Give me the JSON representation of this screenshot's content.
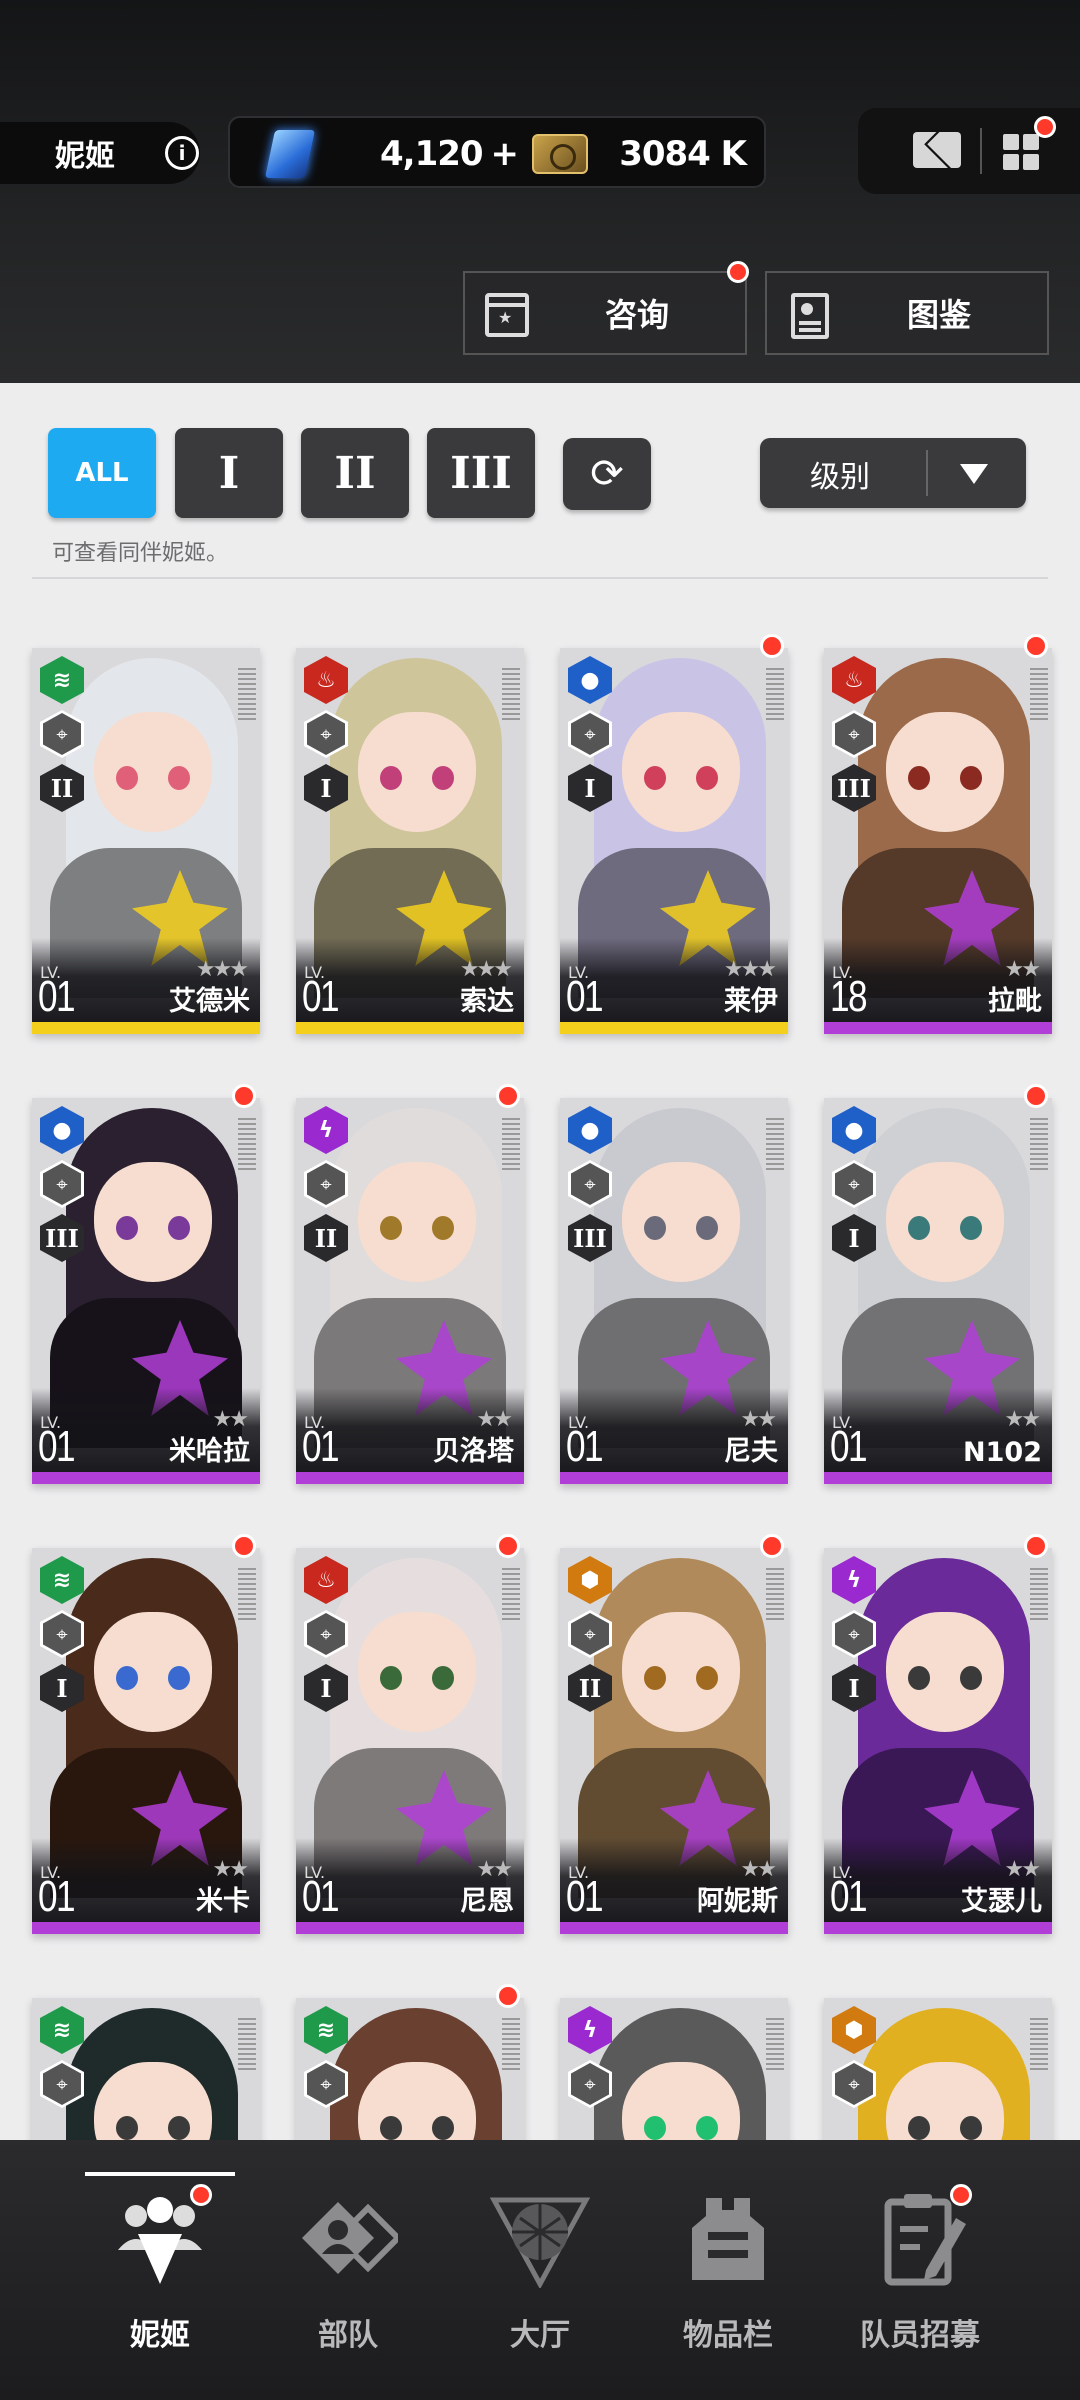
{
  "header": {
    "nikke_label": "妮姬",
    "gems": "4,120",
    "gems_plus": "+",
    "credits": "3084 K",
    "consult_label": "咨询",
    "codex_label": "图鉴"
  },
  "filters": {
    "all": "ALL",
    "burst_1": "I",
    "burst_2": "II",
    "burst_3": "III",
    "sort_label": "级别",
    "hint": "可查看同伴妮姬。"
  },
  "cards": [
    {
      "name": "艾德米",
      "lv_label": "LV.",
      "level": "01",
      "burst": "II",
      "element": "wind",
      "element_color": "#1f9a4a",
      "rarity_strip": "#f4d01c",
      "hair": "#e3e6ea",
      "eye": "#e0607a",
      "dot": false,
      "stars": "★★★"
    },
    {
      "name": "索达",
      "lv_label": "LV.",
      "level": "01",
      "burst": "I",
      "element": "fire",
      "element_color": "#c8281e",
      "rarity_strip": "#f4d01c",
      "hair": "#cfc59a",
      "eye": "#c2407a",
      "dot": false,
      "stars": "★★★"
    },
    {
      "name": "莱伊",
      "lv_label": "LV.",
      "level": "01",
      "burst": "I",
      "element": "water",
      "element_color": "#1f5fc8",
      "rarity_strip": "#f4d01c",
      "hair": "#c9c3e6",
      "eye": "#d0405a",
      "dot": true,
      "stars": "★★★"
    },
    {
      "name": "拉毗",
      "lv_label": "LV.",
      "level": "18",
      "burst": "III",
      "element": "fire",
      "element_color": "#c8281e",
      "rarity_strip": "#b23ed8",
      "hair": "#9a6a4a",
      "eye": "#8a2a20",
      "dot": true,
      "stars": "★★"
    },
    {
      "name": "米哈拉",
      "lv_label": "LV.",
      "level": "01",
      "burst": "III",
      "element": "water",
      "element_color": "#1f5fc8",
      "rarity_strip": "#b23ed8",
      "hair": "#2a2030",
      "eye": "#7a3a9a",
      "dot": true,
      "stars": "★★"
    },
    {
      "name": "贝洛塔",
      "lv_label": "LV.",
      "level": "01",
      "burst": "II",
      "element": "electric",
      "element_color": "#9a2ad0",
      "rarity_strip": "#b23ed8",
      "hair": "#e0dcdc",
      "eye": "#a07a2a",
      "dot": true,
      "stars": "★★"
    },
    {
      "name": "尼夫",
      "lv_label": "LV.",
      "level": "01",
      "burst": "III",
      "element": "water",
      "element_color": "#1f5fc8",
      "rarity_strip": "#b23ed8",
      "hair": "#c9cad0",
      "eye": "#6a6a7a",
      "dot": false,
      "stars": "★★"
    },
    {
      "name": "N102",
      "lv_label": "LV.",
      "level": "01",
      "burst": "I",
      "element": "water",
      "element_color": "#1f5fc8",
      "rarity_strip": "#b23ed8",
      "hair": "#cfd0d4",
      "eye": "#3a7a7a",
      "dot": true,
      "stars": "★★"
    },
    {
      "name": "米卡",
      "lv_label": "LV.",
      "level": "01",
      "burst": "I",
      "element": "wind",
      "element_color": "#1f9a4a",
      "rarity_strip": "#b23ed8",
      "hair": "#4a2a1a",
      "eye": "#3a6ad0",
      "dot": true,
      "stars": "★★"
    },
    {
      "name": "尼恩",
      "lv_label": "LV.",
      "level": "01",
      "burst": "I",
      "element": "fire",
      "element_color": "#c8281e",
      "rarity_strip": "#b23ed8",
      "hair": "#e6dede",
      "eye": "#3a6a3a",
      "dot": true,
      "stars": "★★"
    },
    {
      "name": "阿妮斯",
      "lv_label": "LV.",
      "level": "01",
      "burst": "II",
      "element": "iron",
      "element_color": "#d07a10",
      "rarity_strip": "#b23ed8",
      "hair": "#b08a5a",
      "eye": "#a06a20",
      "dot": true,
      "stars": "★★"
    },
    {
      "name": "艾瑟儿",
      "lv_label": "LV.",
      "level": "01",
      "burst": "I",
      "element": "electric",
      "element_color": "#9a2ad0",
      "rarity_strip": "#b23ed8",
      "hair": "#6a2a9a",
      "eye": "#3a3a3a",
      "dot": true,
      "stars": "★★"
    },
    {
      "name": "",
      "lv_label": "",
      "level": "",
      "burst": "",
      "element": "wind",
      "element_color": "#1f9a4a",
      "rarity_strip": "#b23ed8",
      "hair": "#1f2a2a",
      "eye": "#3a3a3a",
      "dot": false,
      "stars": ""
    },
    {
      "name": "",
      "lv_label": "",
      "level": "",
      "burst": "",
      "element": "wind",
      "element_color": "#1f9a4a",
      "rarity_strip": "#b23ed8",
      "hair": "#6a4030",
      "eye": "#3a3a3a",
      "dot": true,
      "stars": ""
    },
    {
      "name": "",
      "lv_label": "",
      "level": "",
      "burst": "",
      "element": "electric",
      "element_color": "#9a2ad0",
      "rarity_strip": "#b23ed8",
      "hair": "#5a5a5a",
      "eye": "#20c070",
      "dot": false,
      "stars": ""
    },
    {
      "name": "",
      "lv_label": "",
      "level": "",
      "burst": "",
      "element": "iron",
      "element_color": "#d07a10",
      "rarity_strip": "#b23ed8",
      "hair": "#e0b020",
      "eye": "#3a3a3a",
      "dot": false,
      "stars": ""
    }
  ],
  "nav": {
    "nikke": "妮姬",
    "squad": "部队",
    "lobby": "大厅",
    "inventory": "物品栏",
    "recruit": "队员招募"
  }
}
